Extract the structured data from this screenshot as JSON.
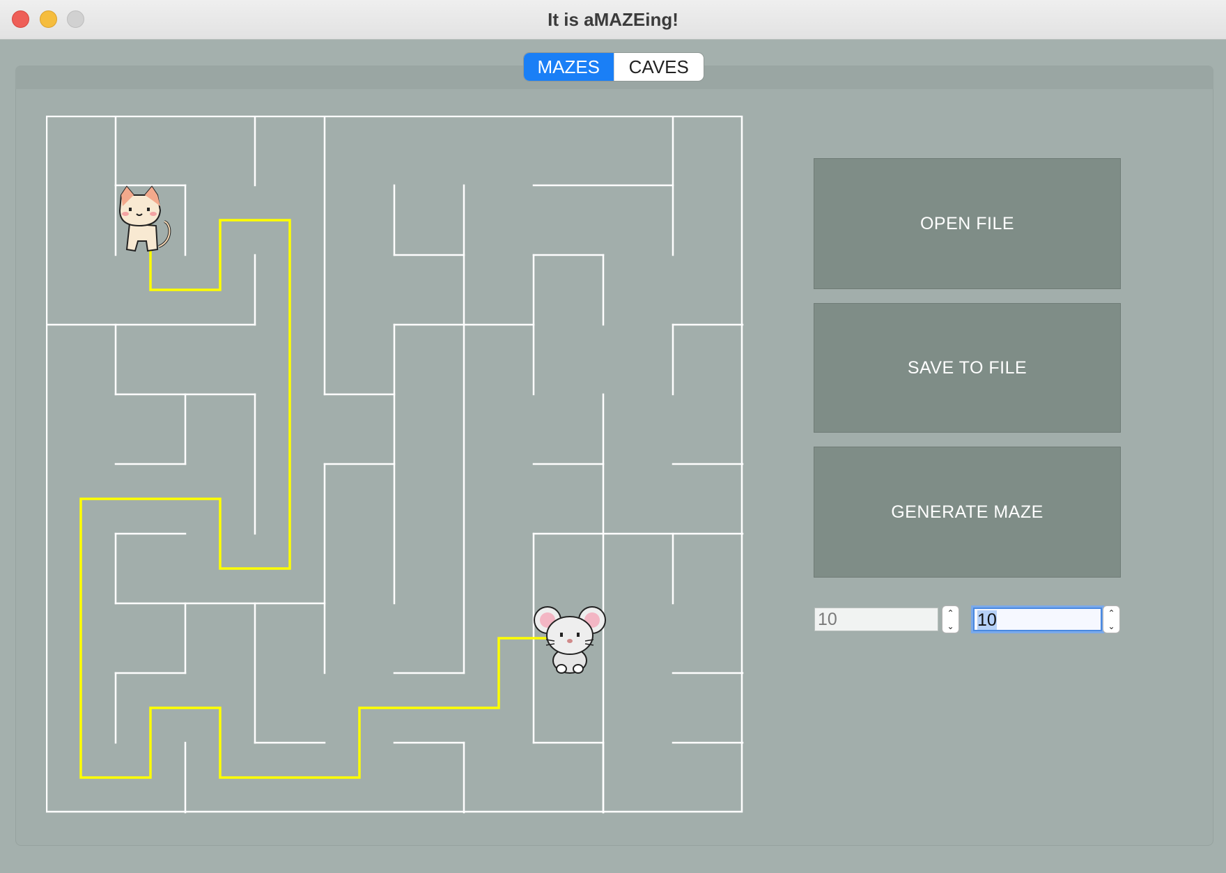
{
  "window": {
    "title": "It is aMAZEing!"
  },
  "tabs": [
    {
      "label": "MAZES",
      "active": true
    },
    {
      "label": "CAVES",
      "active": false
    }
  ],
  "maze": {
    "rows": 10,
    "cols": 10,
    "start_marker": "cat-icon",
    "end_marker": "mouse-icon",
    "wall_color": "#ffffff",
    "path_color": "#ffff00"
  },
  "actions": {
    "open_label": "OPEN FILE",
    "save_label": "SAVE TO FILE",
    "generate_label": "GENERATE MAZE"
  },
  "size_inputs": {
    "rows_value": "10",
    "cols_value": "10"
  },
  "colors": {
    "window_bg": "#a4b0ad",
    "button_bg": "#7f8d87",
    "tab_active": "#1a7ff6"
  }
}
